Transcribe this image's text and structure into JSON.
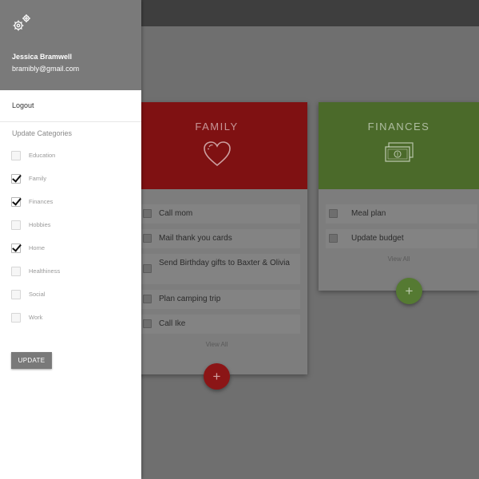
{
  "drawer": {
    "user": {
      "name": "Jessica Bramwell",
      "email": "bramibly@gmail.com"
    },
    "logout_label": "Logout",
    "categories_heading": "Update Categories",
    "categories": [
      {
        "label": "Education",
        "checked": false
      },
      {
        "label": "Family",
        "checked": true
      },
      {
        "label": "Finances",
        "checked": true
      },
      {
        "label": "Hobbies",
        "checked": false
      },
      {
        "label": "Home",
        "checked": true
      },
      {
        "label": "Healthiness",
        "checked": false
      },
      {
        "label": "Social",
        "checked": false
      },
      {
        "label": "Work",
        "checked": false
      }
    ],
    "update_label": "UPDATE"
  },
  "cards": [
    {
      "title": "FAMILY",
      "icon": "heart-icon",
      "color": "#8b1516",
      "tasks": [
        "Call mom",
        "Mail thank you cards",
        "Send Birthday gifts to Baxter & Olivia",
        "Plan camping trip",
        "Call Ike"
      ],
      "view_all": "View All",
      "add_label": "+"
    },
    {
      "title": "FINANCES",
      "icon": "money-icon",
      "color": "#557a32",
      "tasks": [
        "Meal plan",
        "Update budget"
      ],
      "view_all": "View All",
      "add_label": "+"
    }
  ]
}
